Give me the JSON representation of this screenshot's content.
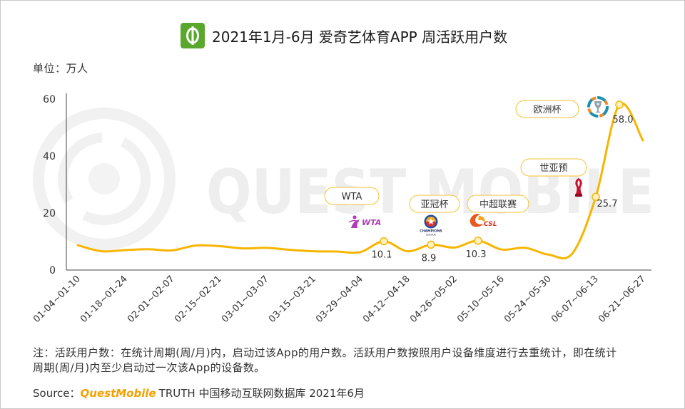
{
  "colors": {
    "line": "#F7B500",
    "callout_border": "#F5C23A",
    "marker_fill": "#FFF1C2",
    "brand": "#F2A100",
    "title_icon": "#59A82D",
    "text": "#333333",
    "watermark": "#EEEEEE"
  },
  "title_icon": "iqiyi-sports-icon",
  "watermark": "QUEST MOBILE",
  "chart_data": {
    "type": "line",
    "title": "2021年1月-6月 爱奇艺体育APP 周活跃用户数",
    "unit_label": "单位：万人",
    "categories": [
      "01-04~01-10",
      "",
      "01-18~01-24",
      "",
      "02-01~02-07",
      "",
      "02-15~02-21",
      "",
      "03-01~03-07",
      "",
      "03-15~03-21",
      "",
      "03-29~04-04",
      "",
      "04-12~04-18",
      "",
      "04-26~05-02",
      "",
      "05-10~05-16",
      "",
      "05-24~05-30",
      "",
      "06-07~06-13",
      "",
      "06-21~06-27"
    ],
    "series": [
      {
        "values": [
          8.7,
          6.6,
          7.0,
          7.3,
          6.9,
          8.6,
          8.4,
          7.6,
          7.8,
          7.1,
          6.6,
          6.5,
          6.3,
          10.1,
          6.6,
          8.9,
          7.9,
          10.3,
          7.2,
          7.8,
          5.4,
          5.8,
          25.7,
          58.0,
          45.5
        ]
      }
    ],
    "data_labels": [
      "",
      "",
      "",
      "",
      "",
      "",
      "",
      "",
      "",
      "",
      "",
      "",
      "",
      "10.1",
      "",
      "8.9",
      "",
      "10.3",
      "",
      "",
      "",
      "",
      "25.7",
      "58.0",
      ""
    ],
    "yticks": [
      0,
      20,
      40,
      60
    ],
    "ylim": [
      0,
      60
    ],
    "smooth": true,
    "grid": false,
    "legend": "none",
    "annotations": [
      {
        "label": "WTA",
        "logo": "wta-logo"
      },
      {
        "label": "亚冠杯",
        "logo": "afc-champions-league-logo"
      },
      {
        "label": "中超联赛",
        "logo": "csl-logo"
      },
      {
        "label": "世亚预",
        "logo": "world-cup-trophy-icon"
      },
      {
        "label": "欧洲杯",
        "logo": "euro-cup-logo"
      }
    ]
  },
  "logos": {
    "wta": "WTA",
    "acl_line1": "CHAMPIONS",
    "acl_line2": "LEAGUE",
    "csl": "CSL"
  },
  "note": {
    "lines": [
      "注：活跃用户数：在统计周期(周/月)内，启动过该App的用户数。活跃用户数按照用户设备维度进行去重统计，即在统计",
      "周期(周/月)内至少启动过一次该App的设备数。"
    ]
  },
  "source": {
    "prefix": "Source：",
    "brand": "QuestMobile",
    "rest": "TRUTH 中国移动互联网数据库 2021年6月"
  }
}
